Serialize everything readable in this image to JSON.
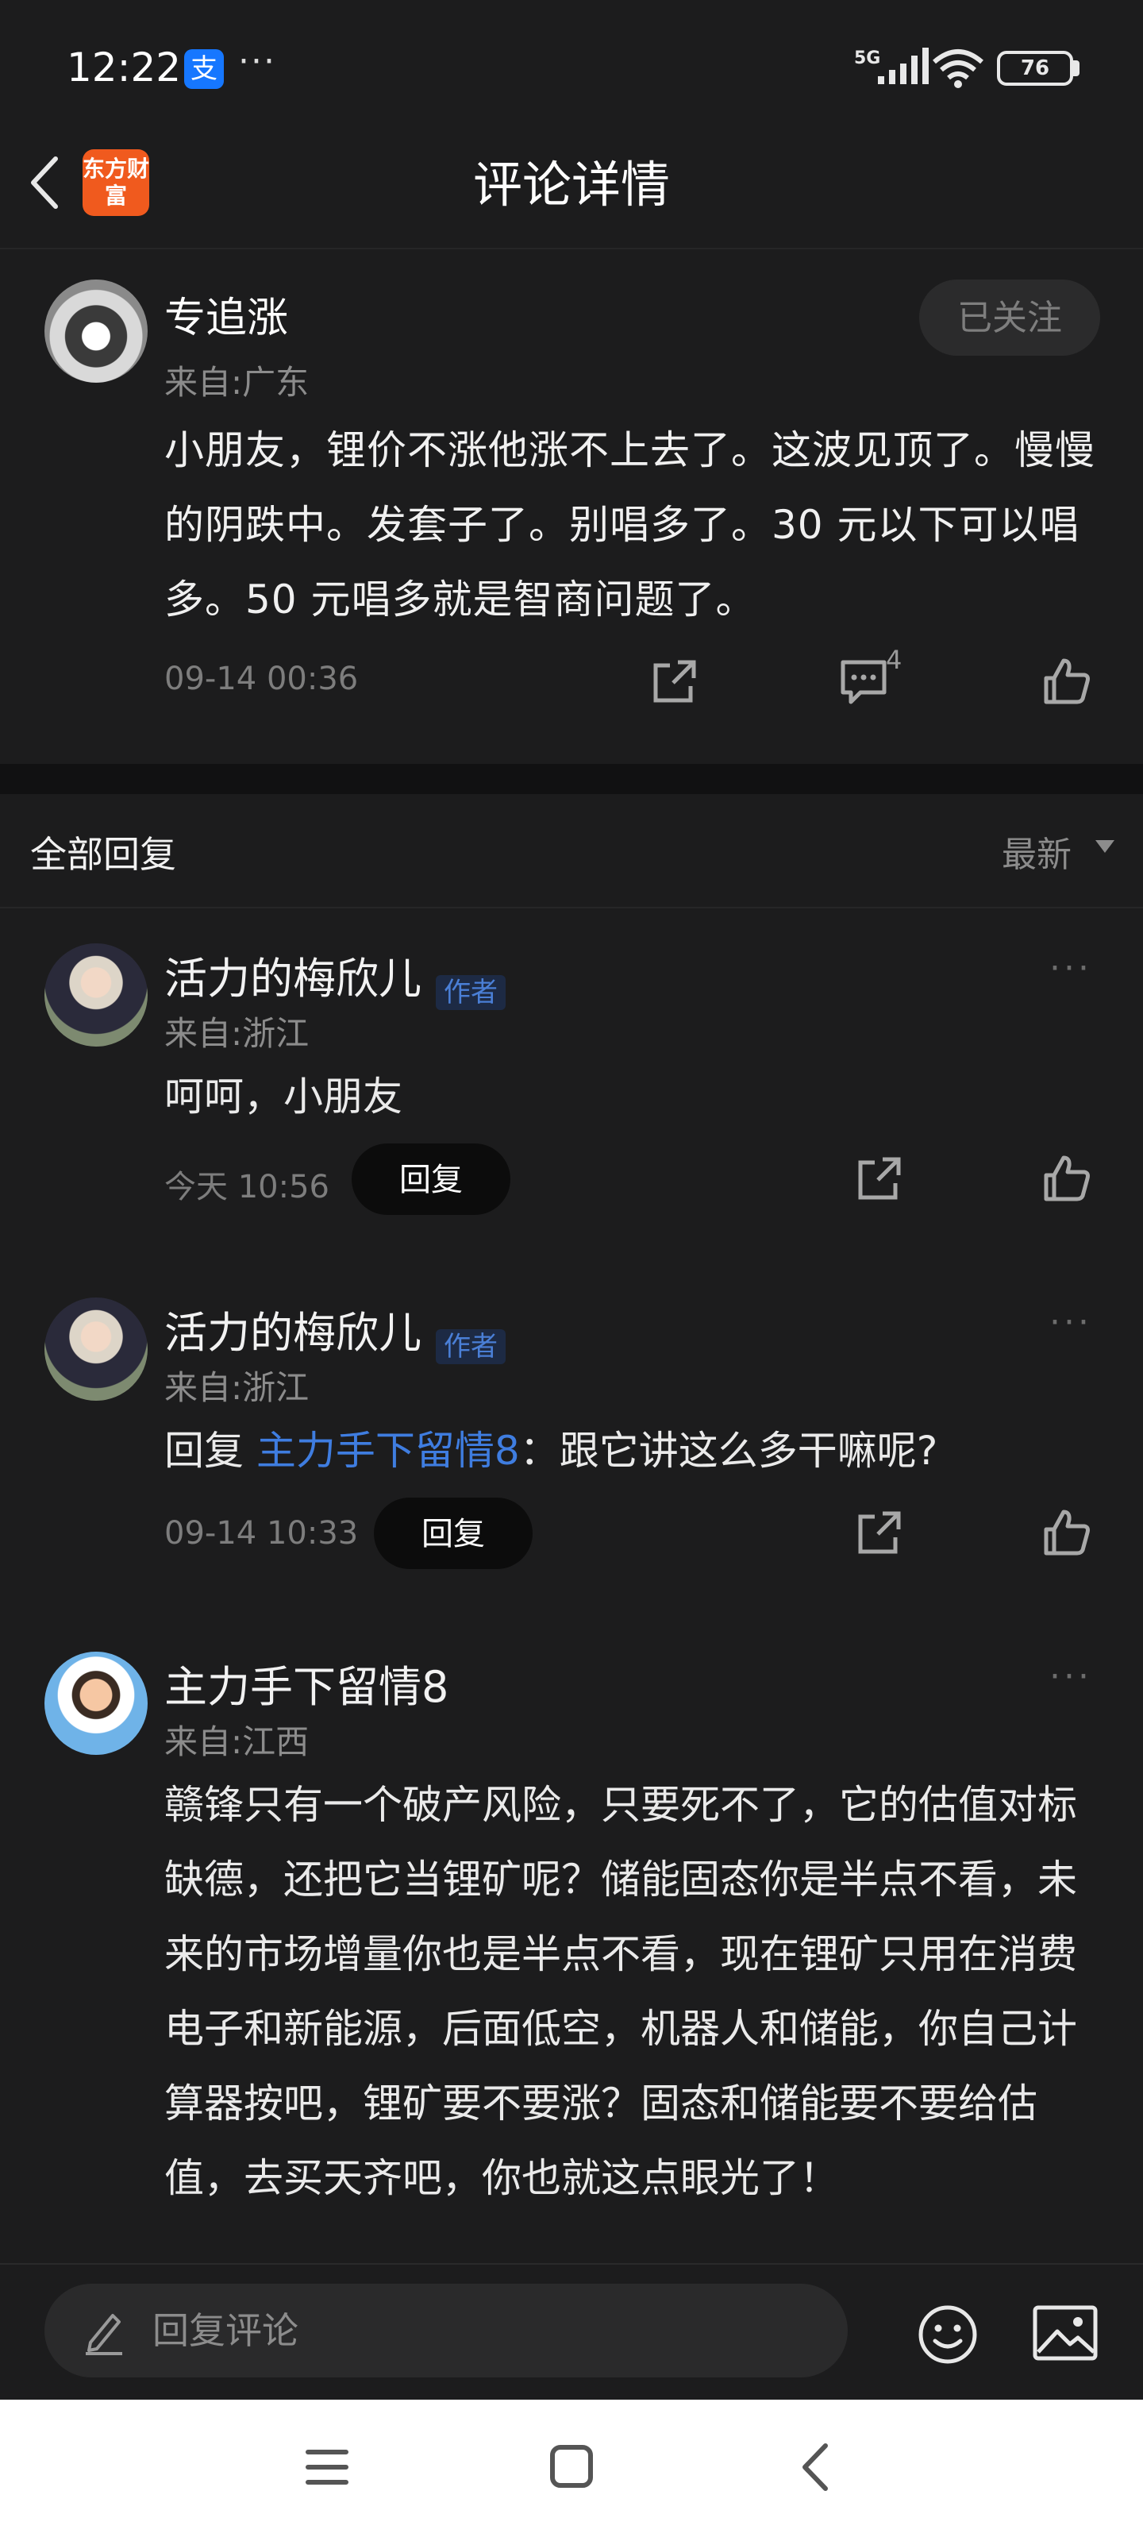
{
  "status_bar": {
    "time": "12:22",
    "app_icon": "支",
    "more": "···",
    "network": "5G",
    "battery": "76",
    "battery_level_percent": 76
  },
  "header": {
    "logo_text": "东方财富",
    "title": "评论详情"
  },
  "post": {
    "username": "专追涨",
    "region": "来自:广东",
    "follow_label": "已关注",
    "content": "小朋友，锂价不涨他涨不上去了。这波见顶了。慢慢的阴跌中。发套子了。别唱多了。30 元以下可以唱多。50 元唱多就是智商问题了。",
    "time": "09-14 00:36",
    "comment_count": "4"
  },
  "replies_header": {
    "label": "全部回复",
    "sort": "最新"
  },
  "replies": [
    {
      "username": "活力的梅欣儿",
      "badge": "作者",
      "region": "来自:浙江",
      "content": "呵呵，小朋友",
      "time": "今天 10:56",
      "reply_label": "回复"
    },
    {
      "username": "活力的梅欣儿",
      "badge": "作者",
      "region": "来自:浙江",
      "prefix": "回复 ",
      "mention": "主力手下留情8",
      "content": "：跟它讲这么多干嘛呢?",
      "time": "09-14 10:33",
      "reply_label": "回复"
    },
    {
      "username": "主力手下留情8",
      "region": "来自:江西",
      "content": "赣锋只有一个破产风险，只要死不了，它的估值对标缺德，还把它当锂矿呢？储能固态你是半点不看，未来的市场增量你也是半点不看，现在锂矿只用在消费电子和新能源，后面低空，机器人和储能，你自己计算器按吧，锂矿要不要涨？固态和储能要不要给估值，去买天齐吧，你也就这点眼光了！"
    }
  ],
  "input_bar": {
    "placeholder": "回复评论"
  },
  "icons": {
    "pencil": "pencil-icon",
    "emoji": "emoji-icon",
    "image": "image-icon",
    "share": "share-icon",
    "comment": "comment-icon",
    "like": "thumbs-up-icon"
  },
  "colors": {
    "background": "#1c1c1d",
    "mention": "#3f7de0",
    "brand": "#f05a1e"
  }
}
